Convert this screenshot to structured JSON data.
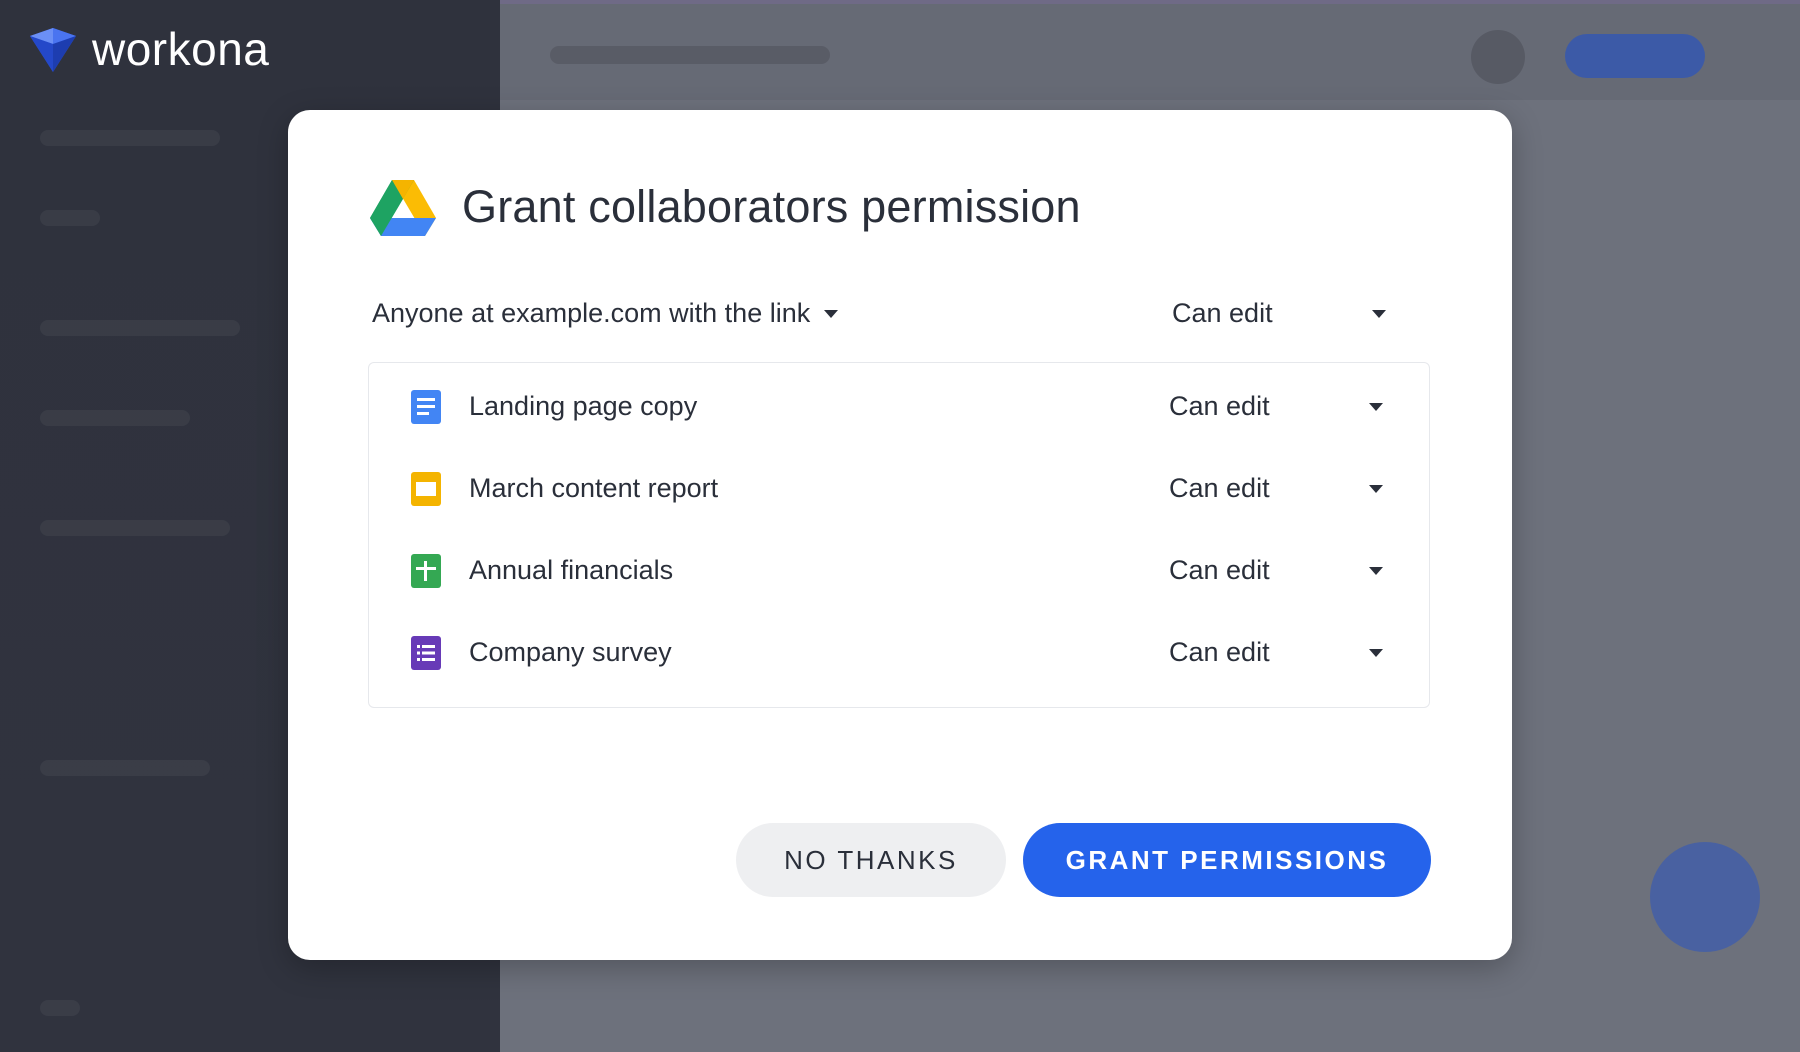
{
  "brand": {
    "name": "workona",
    "logo_icon": "workona-gem-icon",
    "color": "#2f5be8"
  },
  "dialog": {
    "title": "Grant collaborators permission",
    "title_icon": "google-drive-icon",
    "link_scope": "Anyone at example.com with the link",
    "link_permission": "Can edit",
    "files": [
      {
        "name": "Landing page copy",
        "icon": "google-docs-icon",
        "color": "#4285f4",
        "permission": "Can edit"
      },
      {
        "name": "March content report",
        "icon": "google-slides-icon",
        "color": "#f4b400",
        "permission": "Can edit"
      },
      {
        "name": "Annual financials",
        "icon": "google-sheets-icon",
        "color": "#34a853",
        "permission": "Can edit"
      },
      {
        "name": "Company survey",
        "icon": "google-forms-icon",
        "color": "#673ab7",
        "permission": "Can edit"
      }
    ],
    "buttons": {
      "secondary": "NO THANKS",
      "primary": "GRANT PERMISSIONS",
      "primary_color": "#2563eb"
    }
  }
}
